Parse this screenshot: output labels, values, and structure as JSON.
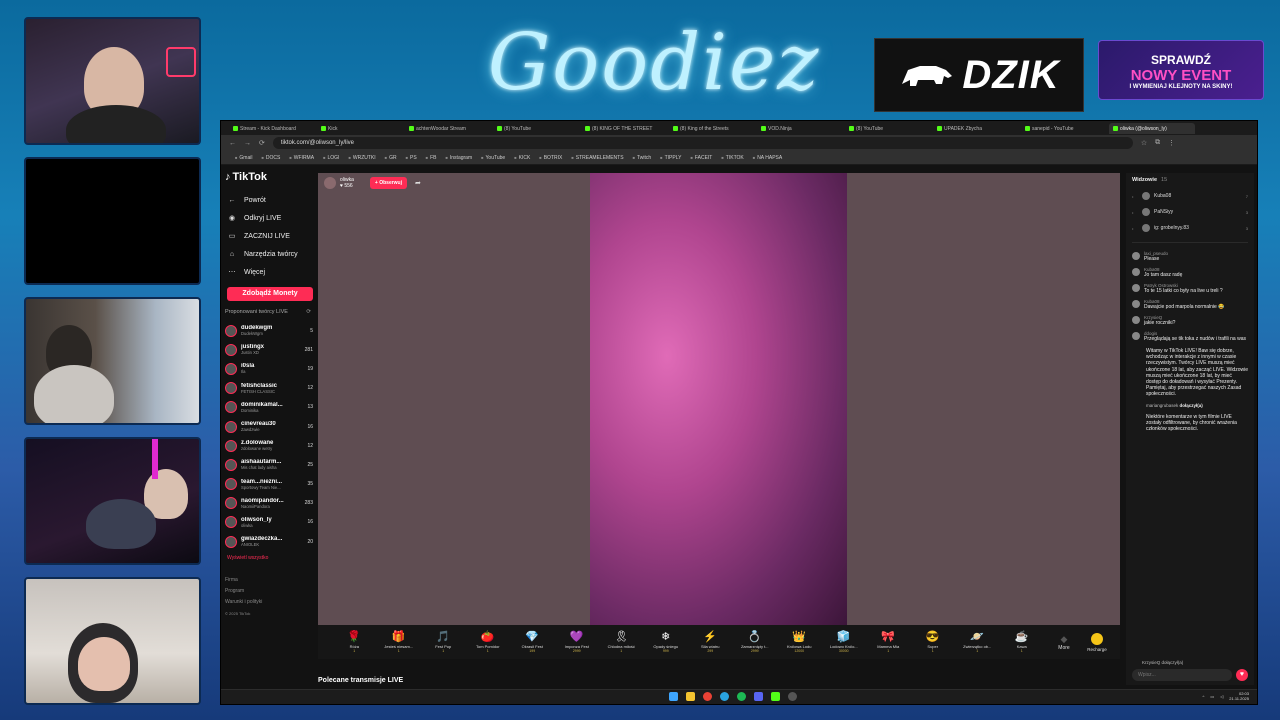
{
  "overlay": {
    "logo_text": "Goodiez",
    "sponsor_main": "DZIK",
    "event_line1": "SPRAWDŹ",
    "event_line2": "NOWY EVENT",
    "event_line3": "I WYMIENIAJ KLEJNOTY NA SKINY!"
  },
  "browser": {
    "tabs": [
      "Stream - Kick Dashboard",
      "Kick",
      "achtenWoodar Stream",
      "(8) YouTube",
      "(8) KING OF THE STREET",
      "(8) King of the Streets",
      "VOD.Ninja",
      "(8) YouTube",
      "UPADEK Zbycha",
      "sanepid - YouTube",
      "oliwka (@oliwson_ly)"
    ],
    "active_tab_index": 10,
    "url": "tiktok.com/@oliwson_ly/live",
    "bookmarks": [
      "Gmail",
      "DOCS",
      "WFIRMA",
      "LOGI",
      "WRZUTKI",
      "GR",
      "PS",
      "FB",
      "Instagram",
      "YouTube",
      "KICK",
      "BOTRIX",
      "STREAMELEMENTS",
      "Twitch",
      "TIPPLY",
      "FACEIT",
      "TIKTOK",
      "NA HAPSA"
    ]
  },
  "tiktok": {
    "logo": "TikTok",
    "nav": [
      {
        "icon": "←",
        "label": "Powrót"
      },
      {
        "icon": "◉",
        "label": "Odkryj LIVE"
      },
      {
        "icon": "▭",
        "label": "ZACZNIJ LIVE"
      },
      {
        "icon": "⌂",
        "label": "Narzędzia twórcy"
      },
      {
        "icon": "⋯",
        "label": "Więcej"
      }
    ],
    "coins_button": "Zdobądź Monety",
    "suggested_title": "Proponowani twórcy LIVE",
    "creators": [
      {
        "name": "dudekwgm",
        "sub": "DudekWgm",
        "count": "5"
      },
      {
        "name": "justingx",
        "sub": "Justin XD",
        "count": "281"
      },
      {
        "name": "i0sla",
        "sub": "Ila",
        "count": "19"
      },
      {
        "name": "fetishclassic",
        "sub": "FETISH CLASSIC",
        "count": "12"
      },
      {
        "name": "dominikamal...",
        "sub": "Dominika",
        "count": "13"
      },
      {
        "name": "cinevreau30",
        "sub": "Zawdzwie",
        "count": "16"
      },
      {
        "name": "z.dolowane",
        "sub": "zdolowane wetry",
        "count": "12"
      },
      {
        "name": "aishaautarm...",
        "sub": "Mis chat lady aisha",
        "count": "25"
      },
      {
        "name": "team...niezni...",
        "sub": "Sportowy Team Nie...",
        "count": "35"
      },
      {
        "name": "naomipandor...",
        "sub": "NaomiiPandora",
        "count": "283"
      },
      {
        "name": "oliwson_ly",
        "sub": "oliwka",
        "count": "16"
      },
      {
        "name": "gwiazdeczka...",
        "sub": "ANIOLEK",
        "count": "20"
      }
    ],
    "see_all": "Wyświetl wszystko",
    "footer": [
      "Firma",
      "Program",
      "Warunki i polityki"
    ],
    "copyright": "© 2025 TikTok",
    "host": {
      "name": "oliwka",
      "likes": "♥ 556"
    },
    "follow_button": "+ Obserwuj",
    "gifts": [
      {
        "icon": "🌹",
        "name": "Róża",
        "price": "1"
      },
      {
        "icon": "🎁",
        "name": "Jesteś niesam...",
        "price": "1"
      },
      {
        "icon": "🎵",
        "name": "Fest Pop",
        "price": "1"
      },
      {
        "icon": "🍅",
        "name": "Tom Pomidor",
        "price": "1"
      },
      {
        "icon": "💎",
        "name": "Okrasił Fest",
        "price": "199"
      },
      {
        "icon": "💜",
        "name": "Imponza Fest",
        "price": "2999"
      },
      {
        "icon": "🎗",
        "name": "Chlodna miłość",
        "price": "1"
      },
      {
        "icon": "❄",
        "name": "Opady śniegu",
        "price": "999"
      },
      {
        "icon": "⚡",
        "name": "Siła wiatru",
        "price": "299"
      },
      {
        "icon": "💍",
        "name": "Zamarznięty t...",
        "price": "2999"
      },
      {
        "icon": "👑",
        "name": "Królowa Lodu",
        "price": "12000"
      },
      {
        "icon": "🧊",
        "name": "Lodowo Królo...",
        "price": "30000"
      },
      {
        "icon": "🎀",
        "name": "Mamma Mia",
        "price": "1"
      },
      {
        "icon": "😎",
        "name": "Super",
        "price": "1"
      },
      {
        "icon": "🪐",
        "name": "Zwierzątko ob...",
        "price": "1"
      },
      {
        "icon": "☕",
        "name": "Kawa",
        "price": "1"
      }
    ],
    "more_label": "More",
    "recharge_label": "Recharge",
    "recommend_label": "Polecane transmisje LIVE",
    "chat": {
      "viewers_label": "Widzowie",
      "viewers_count": "15",
      "top_viewers": [
        {
          "name": "Kuba08",
          "count": "7"
        },
        {
          "name": "PaNSiyy",
          "count": "3"
        },
        {
          "name": "ig: grobelnyy.83",
          "count": "3"
        }
      ],
      "messages": [
        {
          "user": "laxi_pseudo",
          "text": "Please"
        },
        {
          "user": "Kuba08",
          "text": "Jo tam dasz radę"
        },
        {
          "user": "Patryk Ostrowski",
          "text": "To te 15 latki co były na live u treli ?"
        },
        {
          "user": "Kuba08",
          "text": "Dawajcie pod marpola normalnie 😂"
        },
        {
          "user": "KrzysieQ",
          "text": "jakie roczniki?"
        },
        {
          "user": "ddogis",
          "text": "Przeglądają se tik toka z nudów i trafili na was"
        }
      ],
      "system_message": "Witamy w TikTok LIVE! Baw się dobrze, wchodząc w interakcje z innymi w czasie rzeczywistym. Twórcy LIVE muszą mieć ukończone 18 lat, aby zacząć LIVE. Widzowie muszą mieć ukończone 18 lat, by mieć dostęp do doładowań i wysyłać Prezenty. Pamiętaj, aby przestrzegać naszych Zasad społeczności.",
      "joined_user": "mariangrubasek",
      "joined_text": "dołączył(a)",
      "moderation_note": "Niektóre komentarze w tym filmie LIVE zostały odfiltrowane, by chronić wrażenia członków społeczności.",
      "bottom_user": "KrzysieQ",
      "bottom_text": "dołączył(a)",
      "input_placeholder": "Wpisz..."
    }
  },
  "taskbar": {
    "time": "02:03",
    "date": "21.11.2025"
  },
  "colors": {
    "tiktok_red": "#fe2c55",
    "kick_green": "#53fc18"
  }
}
